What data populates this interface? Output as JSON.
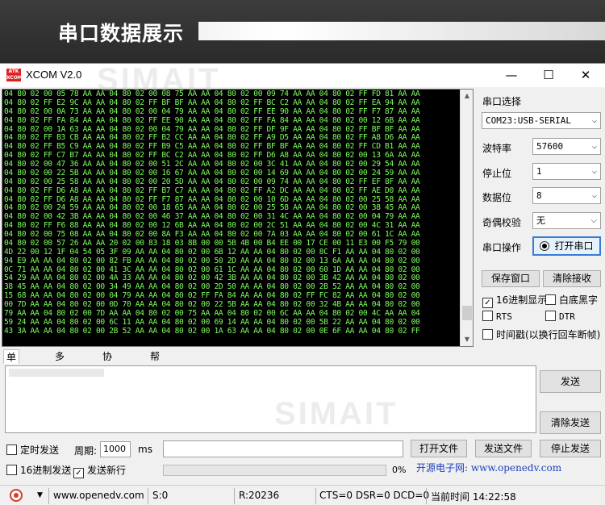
{
  "banner": {
    "title": "串口数据展示"
  },
  "window": {
    "title": "XCOM V2.0",
    "icon_text": "ALIENTEK",
    "watermark": "SIMAIT",
    "minimize": "—",
    "maximize": "☐",
    "close": "✕"
  },
  "receive": {
    "lines": [
      "04 80 02 00 05 78 AA AA 04 80 02 00 08 75 AA AA 04 80 02 00 09 74 AA AA 04 80 02 FF FD 81 AA AA",
      "04 80 02 FF E2 9C AA AA 04 80 02 FF BF BF AA AA 04 80 02 FF BC C2 AA AA 04 80 02 FF EA 94 AA AA",
      "04 80 02 00 0A 73 AA AA 04 80 02 00 04 79 AA AA 04 80 02 FF EE 90 AA AA 04 80 02 FF F7 87 AA AA",
      "04 80 02 FF FA 84 AA AA 04 80 02 FF EE 90 AA AA 04 80 02 FF FA 84 AA AA 04 80 02 00 12 6B AA AA",
      "04 80 02 00 1A 63 AA AA 04 80 02 00 04 79 AA AA 04 80 02 FF DF 9F AA AA 04 80 02 FF BF BF AA AA",
      "04 80 02 FF B3 CB AA AA 04 80 02 FF B2 CC AA AA 04 80 02 FF A9 D5 AA AA 04 80 02 FF A8 D6 AA AA",
      "04 80 02 FF B5 C9 AA AA 04 80 02 FF B9 C5 AA AA 04 80 02 FF BF BF AA AA 04 80 02 FF CD B1 AA AA",
      "04 80 02 FF C7 B7 AA AA 04 80 02 FF BC C2 AA AA 04 80 02 FF D6 A8 AA AA 04 80 02 00 13 6A AA AA",
      "04 80 02 00 47 36 AA AA 04 80 02 00 51 2C AA AA 04 80 02 00 3C 41 AA AA 04 80 02 00 29 54 AA AA",
      "04 80 02 00 22 5B AA AA 04 80 02 00 16 67 AA AA 04 80 02 00 14 69 AA AA 04 80 02 00 24 59 AA AA",
      "04 80 02 00 25 58 AA AA 04 80 02 00 20 5D AA AA 04 80 02 00 09 74 AA AA 04 80 02 FF EF 8F AA AA",
      "04 80 02 FF D6 A8 AA AA 04 80 02 FF B7 C7 AA AA 04 80 02 FF A2 DC AA AA 04 80 02 FF AE D0 AA AA",
      "04 80 02 FF D6 A8 AA AA 04 80 02 FF F7 87 AA AA 04 80 02 00 10 6D AA AA 04 80 02 00 25 58 AA AA",
      "04 80 02 00 24 59 AA AA 04 80 02 00 18 65 AA AA 04 80 02 00 25 58 AA AA 04 80 02 00 38 45 AA AA",
      "04 80 02 00 42 3B AA AA 04 80 02 00 46 37 AA AA 04 80 02 00 31 4C AA AA 04 80 02 00 04 79 AA AA",
      "04 80 02 FF F6 88 AA AA 04 80 02 00 12 6B AA AA 04 80 02 00 2C 51 AA AA 04 80 02 00 4C 31 AA AA",
      "04 80 02 00 75 08 AA AA 04 80 02 00 8A F3 AA AA 04 80 02 00 7A 03 AA AA 04 80 02 00 61 1C AA AA",
      "04 80 02 00 57 26 AA AA 20 02 00 83 18 03 8B 00 00 5B 4B 00 B4 EE 00 17 CE 00 11 E3 00 F5 79 00",
      "4D 22 00 12 1F 04 54 05 3F 09 AA AA 04 80 02 00 6B 12 AA AA 04 80 02 00 8C F1 AA AA 04 80 02 00",
      "94 E9 AA AA 04 80 02 00 82 FB AA AA 04 80 02 00 50 2D AA AA 04 80 02 00 13 6A AA AA 04 80 02 00",
      "0C 71 AA AA 04 80 02 00 41 3C AA AA 04 80 02 00 61 1C AA AA 04 80 02 00 60 1D AA AA 04 80 02 00",
      "54 29 AA AA 04 80 02 00 4A 33 AA AA 04 80 02 00 42 3B AA AA 04 80 02 00 3B 42 AA AA 04 80 02 00",
      "38 45 AA AA 04 80 02 00 34 49 AA AA 04 80 02 00 2D 50 AA AA 04 80 02 00 2B 52 AA AA 04 80 02 00",
      "15 68 AA AA 04 80 02 00 04 79 AA AA 04 80 02 FF FA 84 AA AA 04 80 02 FF FC 82 AA AA 04 80 02 00",
      "00 7D AA AA 04 80 02 00 0D 70 AA AA 04 80 02 00 22 5B AA AA 04 80 02 00 32 4B AA AA 04 80 02 00",
      "79 AA AA 04 80 02 00 7D AA AA 04 80 02 00 75 AA AA 04 80 02 00 6C AA AA 04 80 02 00 4C AA AA 04",
      "59 24 AA AA 04 80 02 00 6C 11 AA AA 04 80 02 00 69 14 AA AA 04 80 02 00 5B 22 AA AA 04 80 02 00",
      "43 3A AA AA 04 80 02 00 2B 52 AA AA 04 80 02 00 1A 63 AA AA 04 80 02 00 0E 6F AA AA 04 80 02 FF"
    ]
  },
  "panel": {
    "port_label": "串口选择",
    "port_value": "COM23:USB-SERIAL",
    "baud_label": "波特率",
    "baud_value": "57600",
    "stop_label": "停止位",
    "stop_value": "1",
    "data_label": "数据位",
    "data_value": "8",
    "parity_label": "奇偶校验",
    "parity_value": "无",
    "op_label": "串口操作",
    "open_button": "打开串口",
    "save_button": "保存窗口",
    "clear_recv_button": "清除接收",
    "hex_display": "16进制显示",
    "white_bg": "白底黑字",
    "rts": "RTS",
    "dtr": "DTR",
    "timestamp": "时间戳(以换行回车断帧)"
  },
  "tabs": [
    "单条发送",
    "多条发送",
    "协议传输",
    "帮助"
  ],
  "send": {
    "send_button": "发送",
    "clear_send_button": "清除发送",
    "timed_send": "定时发送",
    "period_label": "周期:",
    "period_value": "1000",
    "period_unit": "ms",
    "open_file": "打开文件",
    "send_file": "发送文件",
    "stop_send": "停止发送",
    "hex_send": "16进制发送",
    "newline": "发送新行",
    "progress": "0%",
    "progress_value": 0,
    "site_text": "开源电子网: www.openedv.com"
  },
  "status": {
    "url": "www.openedv.com",
    "sent": "S:0",
    "received": "R:20236",
    "lines": "CTS=0 DSR=0 DCD=0",
    "time": "当前时间 14:22:58"
  }
}
